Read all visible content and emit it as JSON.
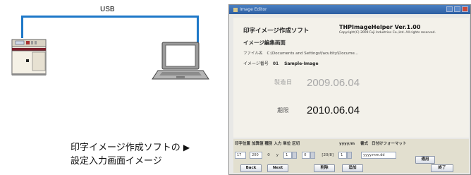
{
  "diagram": {
    "usb_label": "USB",
    "caption_line1": "印字イメージ作成ソフトの",
    "caption_arrow": "▶",
    "caption_line2": "設定入力画面イメージ",
    "cable_color": "#1e78c8"
  },
  "window": {
    "title": "Image Editor",
    "app_title": "印字イメージ作成ソフト",
    "app_version": "THPImageHelper Ver.1.00",
    "copyright": "Copyright(C) 2009 Fuji Industries Co.,Ltd. All rights reserved.",
    "mode_title": "イメージ編集画面",
    "file_label": "ファイル名",
    "file_path": "C:\\Documents and Settings\\facultity\\Docume...",
    "image_no_label": "イメージ番号",
    "image_no": "01",
    "image_name": "Sample-Image",
    "preview": {
      "label1": "製造日",
      "value1": "2009.06.04",
      "label2": "期限",
      "value2": "2010.06.04"
    },
    "settings": {
      "headers": [
        "印字位置",
        "加算値",
        "種別",
        "入力",
        "単位",
        "区切"
      ],
      "header_mid": "yyyy/m",
      "header_mid2": "書式",
      "header_right": "日付けフォーマット",
      "fields": [
        "17",
        "200",
        "0",
        "y",
        "1",
        "0",
        "1"
      ],
      "unit_text": "[20/8]",
      "format_value": "yyyy.mm.dd"
    },
    "buttons": {
      "apply": "適用",
      "back": "Back",
      "next": "Next",
      "delete": "削除",
      "add": "追加",
      "finish": "終了"
    }
  }
}
